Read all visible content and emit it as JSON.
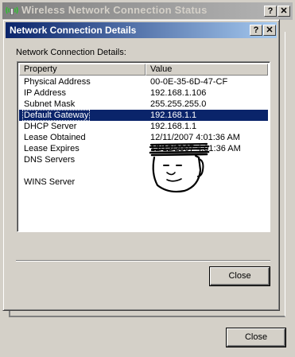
{
  "outer_window": {
    "title": "Wireless Network Connection Status",
    "help_button": "?",
    "close_x": "✕",
    "close_label": "Close"
  },
  "dialog": {
    "title": "Network Connection Details",
    "help_button": "?",
    "close_x": "✕",
    "group_label": "Network Connection Details:",
    "columns": {
      "property": "Property",
      "value": "Value"
    },
    "rows": [
      {
        "property": "Physical Address",
        "value": "00-0E-35-6D-47-CF"
      },
      {
        "property": "IP Address",
        "value": "192.168.1.106"
      },
      {
        "property": "Subnet Mask",
        "value": "255.255.255.0"
      },
      {
        "property": "Default Gateway",
        "value": "192.168.1.1"
      },
      {
        "property": "DHCP Server",
        "value": "192.168.1.1"
      },
      {
        "property": "Lease Obtained",
        "value": "12/11/2007 4:01:36 AM"
      },
      {
        "property": "Lease Expires",
        "value": "12/12/2007 4:01:36 AM"
      },
      {
        "property": "DNS Servers",
        "value": ""
      },
      {
        "property": "",
        "value": ""
      },
      {
        "property": "WINS Server",
        "value": ""
      }
    ],
    "selected_row": "Default Gateway",
    "close_label": "Close"
  },
  "colors": {
    "dialog_face": "#d4d0c8",
    "active_title": "#0a246a",
    "inactive_title": "#808080",
    "selection": "#0a246a"
  }
}
